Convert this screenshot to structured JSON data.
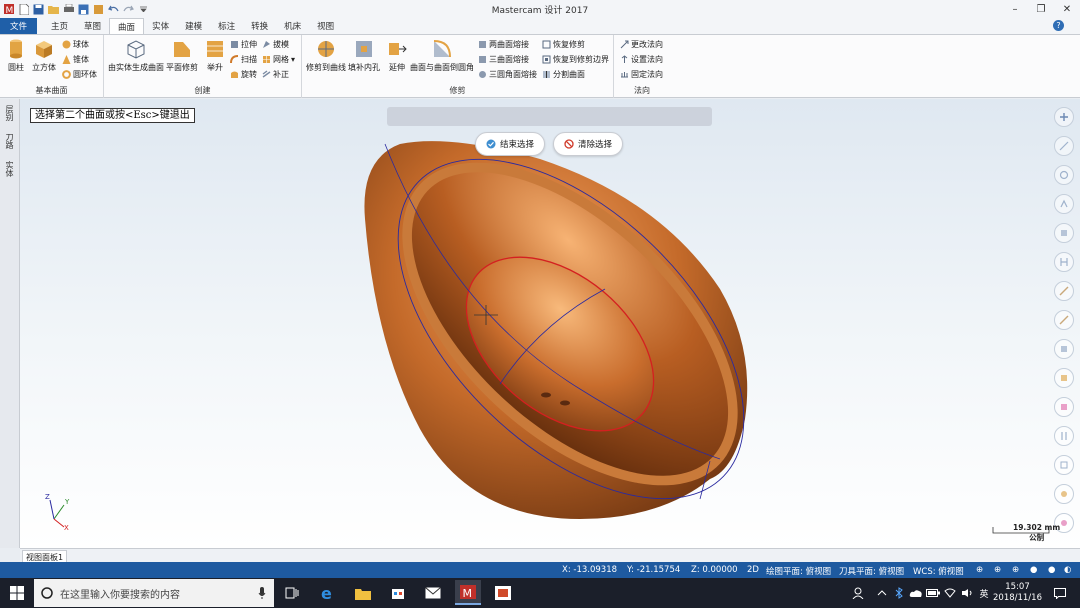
{
  "app": {
    "title": "Mastercam 设计 2017"
  },
  "tabs": [
    {
      "label": "文件"
    },
    {
      "label": "主页"
    },
    {
      "label": "草图"
    },
    {
      "label": "曲面"
    },
    {
      "label": "实体"
    },
    {
      "label": "建模"
    },
    {
      "label": "标注"
    },
    {
      "label": "转换"
    },
    {
      "label": "机床"
    },
    {
      "label": "视图"
    }
  ],
  "ribbon": {
    "basic": {
      "label": "基本曲面",
      "cylinder": "圆柱",
      "cube": "立方体",
      "sphere": "球体",
      "cone": "锥体",
      "torus": "圆环体"
    },
    "create": {
      "label": "创建",
      "from_solid": "由实体生成曲面",
      "flat_trim": "平面修剪",
      "loft": "举升",
      "extrude": "拉伸",
      "sweep": "扫描",
      "revolve": "旋转",
      "draft": "拔模",
      "net": "网格",
      "offset": "补正"
    },
    "trim": {
      "label": "修剪",
      "trim_to_curve": "修剪到曲线",
      "fill_holes": "填补内孔",
      "extend": "延伸",
      "surface_fillet": "曲面与曲面倒圆角",
      "fillet_two": "两曲面熔接",
      "fillet_three": "三曲面熔接",
      "fillet_three_corner": "三圆角面熔接",
      "untrim": "恢复修剪",
      "untrim_boundary": "恢复到修剪边界",
      "split": "分割曲面"
    },
    "normal": {
      "label": "法向",
      "change": "更改法向",
      "set": "设置法向",
      "fix": "固定法向"
    }
  },
  "side_tabs": [
    "层别",
    "刀路",
    "实体"
  ],
  "viewport": {
    "prompt": "选择第二个曲面或按<Esc>键退出",
    "end_select": "结束选择",
    "clear_select": "清除选择",
    "scale_value": "19.302 mm",
    "scale_unit": "公制",
    "panel_tab": "视图面板1",
    "colors": {
      "copper_light": "#f0a060",
      "copper_dark": "#7a3a12",
      "curve_blue": "#2a2aa0",
      "curve_red": "#d42020"
    }
  },
  "status": {
    "x": "X:   -13.09318",
    "y": "Y:   -21.15754",
    "z": "Z:   0.00000",
    "mode": "2D",
    "plane": "绘图平面: 俯视图",
    "tool_plane": "刀具平面: 俯视图",
    "wcs": "WCS: 俯视图"
  },
  "taskbar": {
    "search_placeholder": "在这里输入你要搜索的内容",
    "ime": "英",
    "time": "15:07",
    "date": "2018/11/16"
  }
}
